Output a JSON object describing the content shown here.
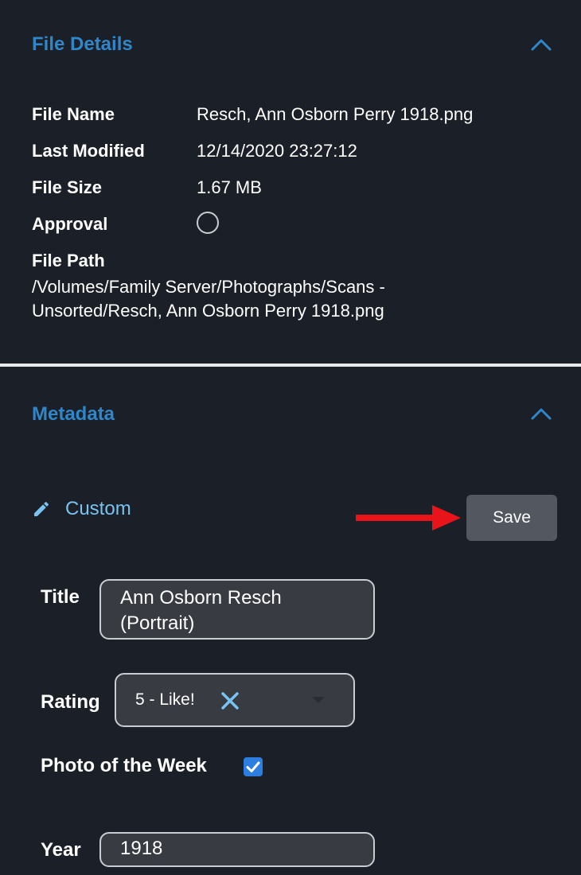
{
  "file_details": {
    "title": "File Details",
    "rows": [
      {
        "label": "File Name",
        "value": "Resch, Ann Osborn Perry 1918.png"
      },
      {
        "label": "Last Modified",
        "value": "12/14/2020 23:27:12"
      },
      {
        "label": "File Size",
        "value": "1.67 MB"
      },
      {
        "label": "Approval",
        "value": ""
      }
    ],
    "file_path_label": "File Path",
    "file_path_line1": "/Volumes/Family Server/Photographs/Scans -",
    "file_path_line2": "Unsorted/Resch, Ann Osborn Perry 1918.png",
    "approval_checked": false
  },
  "metadata": {
    "title": "Metadata",
    "custom_label": "Custom",
    "save_label": "Save",
    "title_field": {
      "label": "Title",
      "value_line1": "Ann Osborn Resch",
      "value_line2": "(Portrait)"
    },
    "rating_field": {
      "label": "Rating",
      "value": "5 - Like!"
    },
    "photo_of_week": {
      "label": "Photo of the Week",
      "checked": true
    },
    "year_field": {
      "label": "Year",
      "value": "1918"
    }
  },
  "colors": {
    "background": "#1b1f27",
    "section_title": "#2f86c9",
    "custom_link": "#78c3f0",
    "button": "#535760",
    "checkbox": "#2c7fe0",
    "arrow": "#e8141a"
  },
  "icons": {
    "collapse": "chevron-up-icon",
    "edit": "pencil-icon",
    "clear": "close-icon",
    "dropdown": "caret-down-icon",
    "annotation": "red-arrow-icon"
  }
}
